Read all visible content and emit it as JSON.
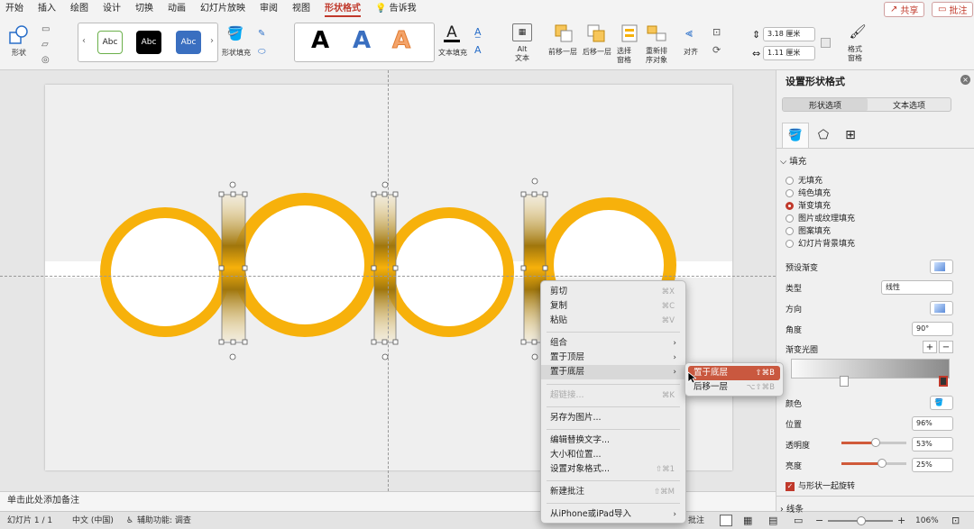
{
  "tabs": [
    "开始",
    "插入",
    "绘图",
    "设计",
    "切换",
    "动画",
    "幻灯片放映",
    "审阅",
    "视图",
    "形状格式",
    "告诉我"
  ],
  "active_tab": "形状格式",
  "share_label": "共享",
  "comment_label": "批注",
  "ribbon": {
    "shape_label": "形状",
    "style_samples": [
      "Abc",
      "Abc",
      "Abc"
    ],
    "shape_fill_label": "形状填充",
    "wordart_samples": [
      "A",
      "A",
      "A"
    ],
    "text_fill_label": "文本填充",
    "alt_text_label": "Alt\n文本",
    "bring_forward_label": "前移一层",
    "send_backward_label": "后移一层",
    "selection_pane_label": "选择\n窗格",
    "reorder_label": "重新排\n序对象",
    "align_label": "对齐",
    "height_value": "3.18 厘米",
    "width_value": "1.11 厘米",
    "format_pane_label": "格式\n窗格"
  },
  "notes_placeholder": "单击此处添加备注",
  "status": {
    "slide": "幻灯片 1 / 1",
    "language": "中文 (中国)",
    "accessibility": "辅助功能: 调查",
    "comment": "批注",
    "zoom": "106%"
  },
  "panel": {
    "title": "设置形状格式",
    "tab_shape": "形状选项",
    "tab_text": "文本选项",
    "fill_section": "填充",
    "fill_options": [
      "无填充",
      "纯色填充",
      "渐变填充",
      "图片或纹理填充",
      "图案填充",
      "幻灯片背景填充"
    ],
    "selected_fill": 2,
    "preset_label": "预设渐变",
    "type_label": "类型",
    "type_value": "线性",
    "direction_label": "方向",
    "angle_label": "角度",
    "angle_value": "90°",
    "stops_label": "渐变光圈",
    "color_label": "颜色",
    "position_label": "位置",
    "position_value": "96%",
    "transparency_label": "透明度",
    "transparency_value": "53%",
    "transparency_level": 0.53,
    "brightness_label": "亮度",
    "brightness_value": "25%",
    "brightness_level": 0.62,
    "rotate_label": "与形状一起旋转",
    "line_section": "线条"
  },
  "context_menu": {
    "items": [
      {
        "label": "剪切",
        "shortcut": "⌘X"
      },
      {
        "label": "复制",
        "shortcut": "⌘C"
      },
      {
        "label": "粘贴",
        "shortcut": "⌘V"
      },
      {
        "label": "组合",
        "submenu": true
      },
      {
        "label": "置于顶层",
        "submenu": true
      },
      {
        "label": "置于底层",
        "submenu": true,
        "highlight": true
      },
      {
        "label": "超链接...",
        "shortcut": "⌘K",
        "disabled": true
      },
      {
        "label": "另存为图片..."
      },
      {
        "label": "编辑替换文字..."
      },
      {
        "label": "大小和位置..."
      },
      {
        "label": "设置对象格式...",
        "shortcut": "⇧⌘1"
      },
      {
        "label": "新建批注",
        "shortcut": "⇧⌘M"
      },
      {
        "label": "从iPhone或iPad导入",
        "submenu": true
      }
    ]
  },
  "submenu": {
    "items": [
      {
        "label": "置于底层",
        "shortcut": "⇧⌘B",
        "active": true
      },
      {
        "label": "后移一层",
        "shortcut": "⌥⇧⌘B"
      }
    ]
  },
  "colors": {
    "accent": "#c0392b",
    "ring": "#F7B10B",
    "ring_dark": "#B27F1A"
  }
}
